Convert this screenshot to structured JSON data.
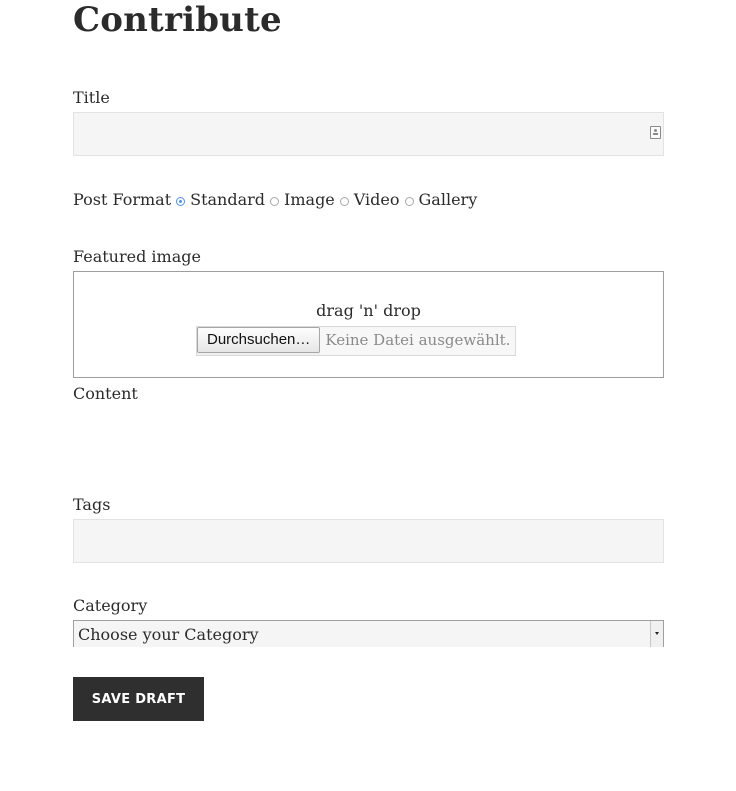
{
  "page": {
    "title": "Contribute"
  },
  "form": {
    "title_field": {
      "label": "Title",
      "value": "",
      "placeholder": "",
      "icon": "contact-card-icon"
    },
    "post_format": {
      "label": "Post Format",
      "options": [
        {
          "label": "Standard",
          "checked": true
        },
        {
          "label": "Image",
          "checked": false
        },
        {
          "label": "Video",
          "checked": false
        },
        {
          "label": "Gallery",
          "checked": false
        }
      ]
    },
    "featured_image": {
      "label": "Featured image",
      "drop_text": "drag 'n' drop",
      "browse_button": "Durchsuchen…",
      "file_status": "Keine Datei ausgewählt."
    },
    "content": {
      "label": "Content"
    },
    "tags": {
      "label": "Tags",
      "value": "",
      "placeholder": ""
    },
    "category": {
      "label": "Category",
      "selected": "Choose your Category"
    },
    "save_button": "SAVE DRAFT"
  },
  "colors": {
    "text": "#2b2b2b",
    "input_bg": "#f5f5f5",
    "button_bg": "#2f2f2f",
    "radio_checked": "#4d90fe"
  }
}
